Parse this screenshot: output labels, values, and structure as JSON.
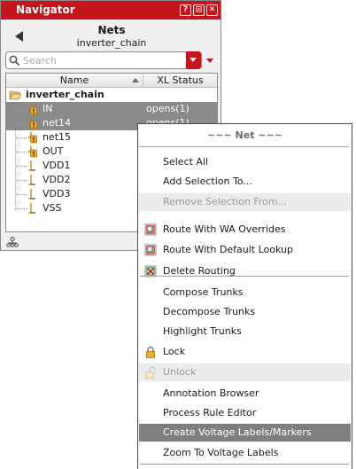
{
  "navigator": {
    "title": "Navigator",
    "window_buttons": [
      "?",
      "⊡",
      "✕"
    ],
    "view_title": "Nets",
    "view_subtitle": "inverter_chain",
    "search": {
      "placeholder": "Search",
      "value": ""
    },
    "columns": {
      "name": "Name",
      "xl_status": "XL Status"
    },
    "tree": {
      "root": "inverter_chain",
      "items": [
        {
          "name": "IN",
          "status": "opens(1)",
          "selected": true,
          "kind": "net-warn"
        },
        {
          "name": "net14",
          "status": "opens(1)",
          "selected": true,
          "kind": "net-warn"
        },
        {
          "name": "net15",
          "status": "",
          "selected": false,
          "kind": "net-warn"
        },
        {
          "name": "OUT",
          "status": "",
          "selected": false,
          "kind": "net-warn"
        },
        {
          "name": "VDD1",
          "status": "",
          "selected": false,
          "kind": "net"
        },
        {
          "name": "VDD2",
          "status": "",
          "selected": false,
          "kind": "net"
        },
        {
          "name": "VDD3",
          "status": "",
          "selected": false,
          "kind": "net"
        },
        {
          "name": "VSS",
          "status": "",
          "selected": false,
          "kind": "net"
        }
      ]
    }
  },
  "context_menu": {
    "header": "~~~ Net ~~~",
    "items": [
      {
        "label": "Select All",
        "state": "normal",
        "icon": ""
      },
      {
        "label": "Add Selection To...",
        "state": "normal",
        "icon": ""
      },
      {
        "label": "Remove Selection From...",
        "state": "disabled",
        "icon": ""
      },
      {
        "label": "Route With WA Overrides",
        "state": "normal",
        "icon": "route-icon"
      },
      {
        "label": "Route With Default Lookup",
        "state": "normal",
        "icon": "route-icon"
      },
      {
        "label": "Delete Routing",
        "state": "normal",
        "icon": "delete-route-icon"
      },
      {
        "label": "Compose Trunks",
        "state": "normal",
        "icon": ""
      },
      {
        "label": "Decompose Trunks",
        "state": "normal",
        "icon": ""
      },
      {
        "label": "Highlight Trunks",
        "state": "normal",
        "icon": ""
      },
      {
        "label": "Lock",
        "state": "normal",
        "icon": "lock-icon"
      },
      {
        "label": "Unlock",
        "state": "disabled",
        "icon": "unlock-icon"
      },
      {
        "label": "Annotation Browser",
        "state": "normal",
        "icon": ""
      },
      {
        "label": "Process Rule Editor",
        "state": "normal",
        "icon": ""
      },
      {
        "label": "Create Voltage Labels/Markers",
        "state": "highlighted",
        "icon": ""
      },
      {
        "label": "Zoom To Voltage Labels",
        "state": "normal",
        "icon": ""
      }
    ]
  },
  "colors": {
    "accent": "#c5141b",
    "selection": "#8a8a8a",
    "menu_highlight": "#7f7f7f"
  }
}
